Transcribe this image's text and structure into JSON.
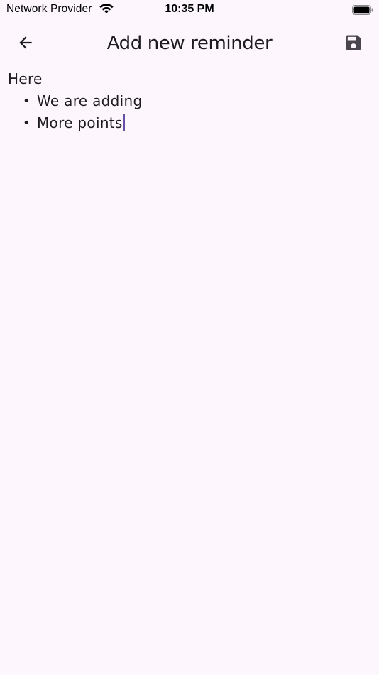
{
  "status_bar": {
    "carrier": "Network Provider",
    "time": "10:35 PM",
    "wifi_icon": "wifi-icon",
    "battery_icon": "battery-icon"
  },
  "app_bar": {
    "title": "Add new reminder",
    "back_icon": "arrow-back-icon",
    "save_icon": "save-icon"
  },
  "editor": {
    "paragraph": "Here",
    "bullets": [
      "We are adding",
      "More points"
    ],
    "caret_color": "#6750a4"
  },
  "colors": {
    "background": "#fdf7fd",
    "text": "#1d1b20",
    "icon": "#49454f"
  }
}
